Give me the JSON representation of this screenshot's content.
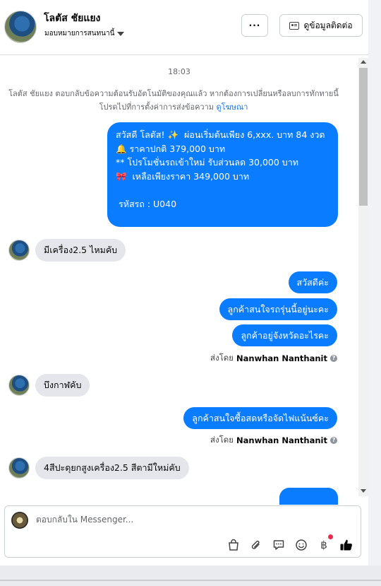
{
  "header": {
    "contact_name": "โลตัส ชัยแยง",
    "assign_label": "มอบหมายการสนทนานี้",
    "more_label": "···",
    "contact_info_label": "ดูข้อมูลติดต่อ"
  },
  "conversation": {
    "timestamp": "18:03",
    "notice_text": "โลตัส ชัยแยง ตอบกลับข้อความต้อนรับอัตโนมัติของคุณแล้ว หากต้องการเปลี่ยนหรือลบการทักทายนี้ โปรดไปที่การตั้งค่าการส่งข้อความ",
    "notice_link": "ดูโฆษณา",
    "welcome_message": "สวัสดี โลตัส! ✨  ผ่อนเริ่มต้นเพียง 6,xxx. บาท 84 งวด\n🔔 ราคาปกติ 379,000 บาท\n** โปรโมชั่นรถเข้าใหม่ รับส่วนลด 30,000 บาท\n🎀  เหลือเพียงราคา 349,000 บาท\n\n รหัสรถ : U040",
    "customer_msg_1": "มีเครื่อง2.5 ไหมคับ",
    "agent_msg_1": "สวัสดีค่ะ",
    "agent_msg_2": "ลูกค้าสนใจรถรุ่นนี้อยู่นะคะ",
    "agent_msg_3": "ลูกค้าอยู่จังหวัดอะไรคะ",
    "sent_by_prefix": "ส่งโดย",
    "agent_name": "Nanwhan Nanthanit",
    "customer_msg_2": "บึงกาฬคับ",
    "agent_msg_4": "ลูกค้าสนใจซื้อสดหรือจัดไฟแน้นซ์คะ",
    "customer_msg_3": "4สีปะดุยกสูงเครื่อง2.5 สีตามีใหม่คับ"
  },
  "composer": {
    "placeholder": "ตอบกลับใน Messenger..."
  },
  "icons": {
    "bag": "shopping-bag-icon",
    "attach": "paperclip-icon",
    "saved_reply": "saved-reply-icon",
    "emoji": "emoji-icon",
    "payment": "baht-icon",
    "like": "thumbs-up-icon"
  },
  "colors": {
    "outgoing_bubble": "#0a7cff",
    "incoming_bubble": "#e4e6eb",
    "link": "#1877f2",
    "notification_dot": "#f02849"
  }
}
